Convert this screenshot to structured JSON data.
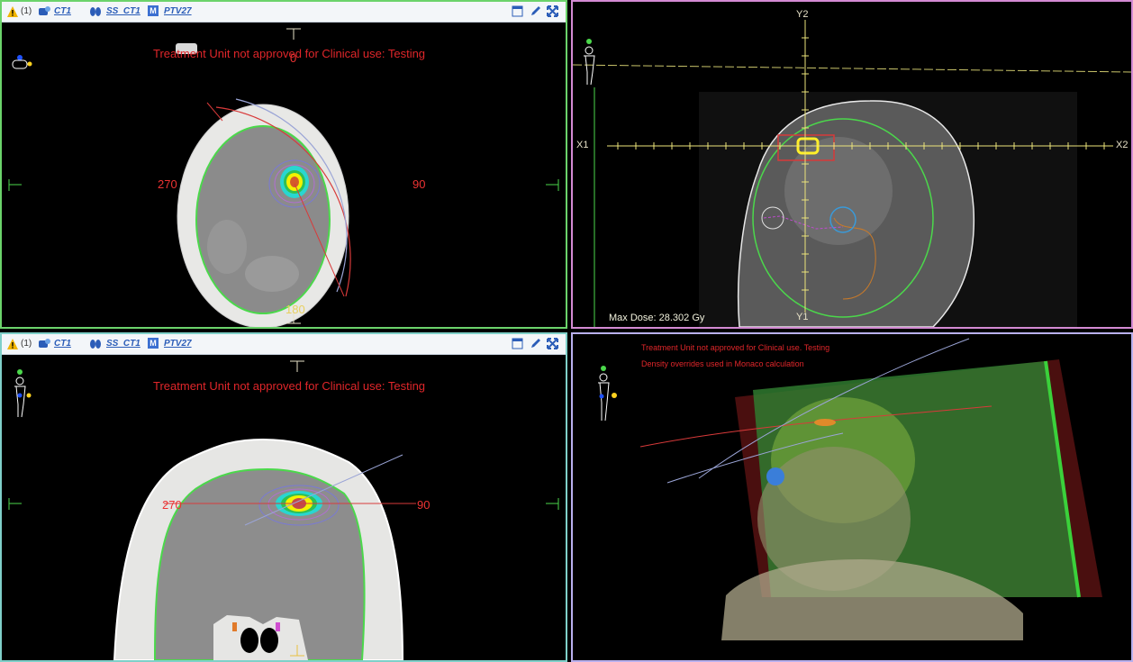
{
  "toolbar": {
    "count": "(1)",
    "ct_link": "CT1",
    "ss_link": "SS_CT1",
    "structure_badge": "M",
    "structure_link": "PTV27"
  },
  "warning": "Treatment Unit not approved for Clinical use: Testing",
  "warning_3d": "Treatment Unit not approved for Clinical use. Testing",
  "density_note": "Density overrides used in Monaco calculation",
  "axial": {
    "gantry_270": "270",
    "gantry_90": "90",
    "gantry_180": "180",
    "gantry_0": "0"
  },
  "beams_eye": {
    "y2": "Y2",
    "y1": "Y1",
    "x1": "X1",
    "x2": "X2",
    "max_dose": "Max Dose: 28.302 Gy"
  },
  "coronal": {
    "gantry_270": "270",
    "gantry_90": "90"
  },
  "colors": {
    "pane_border_axial": "#6bd36b",
    "pane_border_bev": "#d38ad3",
    "pane_border_coronal": "#7fd0c9",
    "pane_border_3d": "#b9b0ee",
    "warning": "#e0262a"
  }
}
